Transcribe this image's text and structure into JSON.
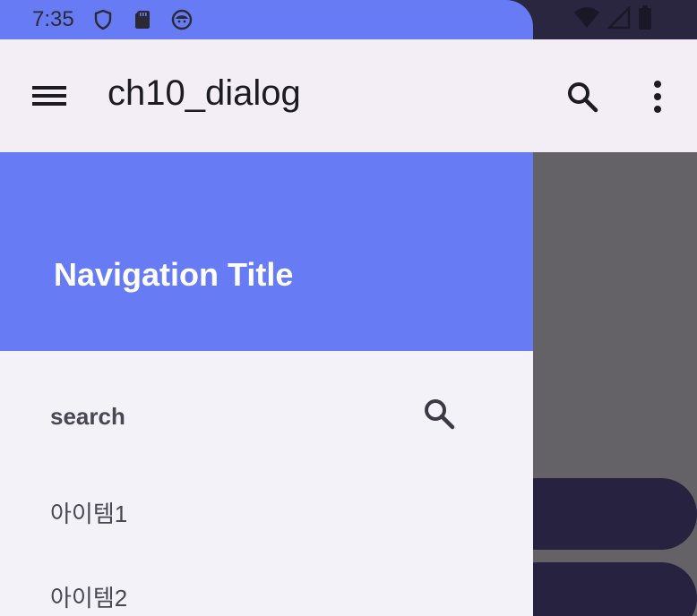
{
  "status_bar": {
    "time": "7:35",
    "icons_left": [
      "shield-icon",
      "sd-card-icon",
      "android-face-icon"
    ],
    "icons_right": [
      "wifi-icon",
      "signal-icon",
      "battery-icon"
    ]
  },
  "app_bar": {
    "title": "ch10_dialog",
    "icons": [
      "menu-icon",
      "search-icon",
      "more-vert-icon"
    ]
  },
  "drawer": {
    "header_title": "Navigation Title",
    "search_label": "search",
    "items": [
      {
        "label": "아이템1"
      },
      {
        "label": "아이템2"
      }
    ]
  },
  "colors": {
    "primary": "#667bf4",
    "app_bar_bg": "#f3edf6",
    "drawer_bg": "#f3f2f8",
    "scrim": "#646266",
    "dark_pill": "#262240"
  }
}
